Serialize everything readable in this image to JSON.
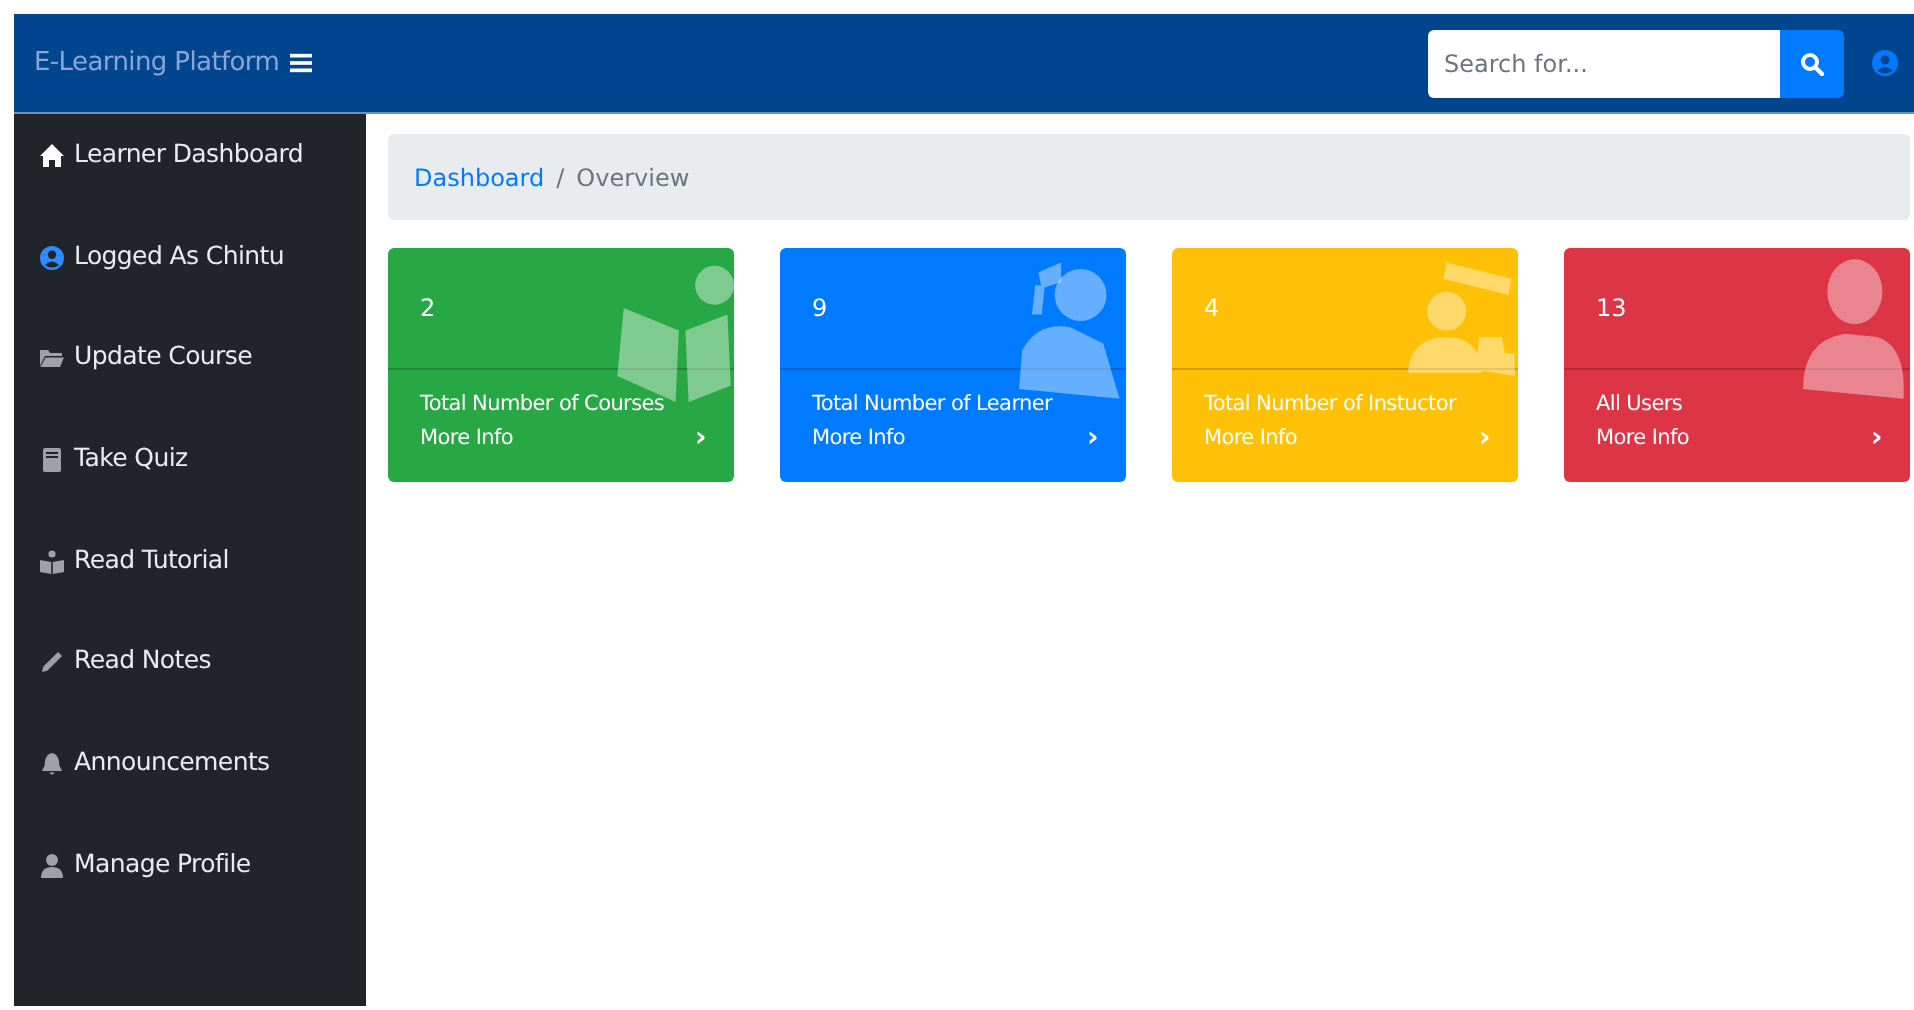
{
  "topbar": {
    "brand": "E-Learning Platform",
    "search": {
      "placeholder": "Search for..."
    }
  },
  "sidebar": {
    "items": [
      {
        "label": "Learner Dashboard"
      },
      {
        "label": "Logged As Chintu"
      },
      {
        "label": "Update Course"
      },
      {
        "label": "Take Quiz"
      },
      {
        "label": "Read Tutorial"
      },
      {
        "label": "Read Notes"
      },
      {
        "label": "Announcements"
      },
      {
        "label": "Manage Profile"
      }
    ]
  },
  "breadcrumb": {
    "link": "Dashboard",
    "separator": "/",
    "current": "Overview"
  },
  "cards": [
    {
      "count": "2",
      "title": "Total Number of Courses",
      "link": "More Info",
      "arrow": "›",
      "color": "#28a745"
    },
    {
      "count": "9",
      "title": "Total Number of Learner",
      "link": "More Info",
      "arrow": "›",
      "color": "#007bff"
    },
    {
      "count": "4",
      "title": "Total Number of Instuctor",
      "link": "More Info",
      "arrow": "›",
      "color": "#ffc107"
    },
    {
      "count": "13",
      "title": "All Users",
      "link": "More Info",
      "arrow": "›",
      "color": "#dc3545"
    }
  ]
}
